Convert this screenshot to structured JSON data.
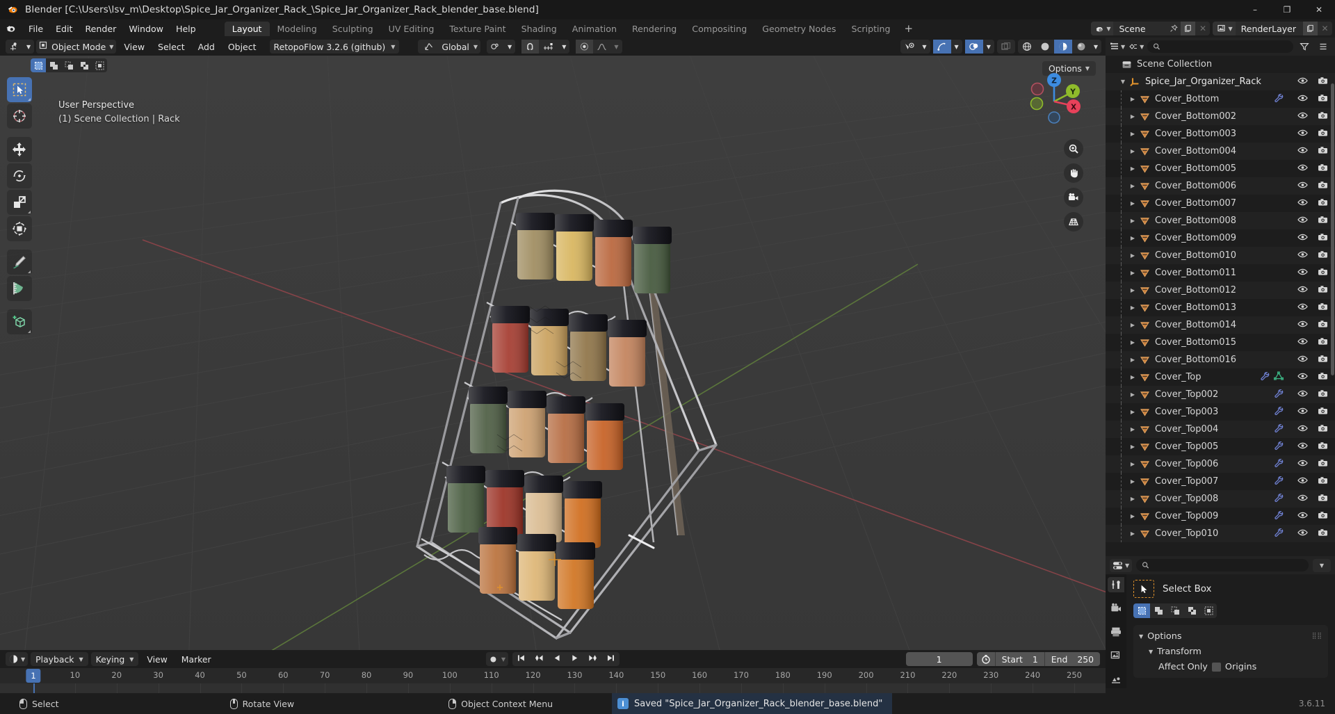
{
  "window": {
    "title": "Blender [C:\\Users\\lsv_m\\Desktop\\Spice_Jar_Organizer_Rack_\\Spice_Jar_Organizer_Rack_blender_base.blend]",
    "minimize": "–",
    "maximize": "❐",
    "close": "✕"
  },
  "menu": {
    "items": [
      "File",
      "Edit",
      "Render",
      "Window",
      "Help"
    ]
  },
  "workspaces": {
    "tabs": [
      "Layout",
      "Modeling",
      "Sculpting",
      "UV Editing",
      "Texture Paint",
      "Shading",
      "Animation",
      "Rendering",
      "Compositing",
      "Geometry Nodes",
      "Scripting"
    ],
    "active": "Layout",
    "add": "+"
  },
  "topbar_right": {
    "scene_name": "Scene",
    "viewlayer_name": "RenderLayer"
  },
  "viewport_header": {
    "mode": "Object Mode",
    "menus": [
      "View",
      "Select",
      "Add",
      "Object"
    ],
    "addon": "RetopoFlow 3.2.6 (github)",
    "transform_orientation": "Global"
  },
  "viewport": {
    "perspective": "User Perspective",
    "collection_line": "(1) Scene Collection | Rack",
    "options_label": "Options",
    "gizmo_axes": {
      "x": "X",
      "y": "Y",
      "z": "Z"
    },
    "colors": {
      "x_axis": "#e7415a",
      "y_axis": "#8fbb2b",
      "z_axis": "#3d8ce0",
      "accent": "#4772b3",
      "orange": "#e0922c"
    }
  },
  "toolbar": {
    "tools": [
      {
        "name": "tweak-tool",
        "icon": "cursor-arrow",
        "active": true
      },
      {
        "name": "cursor-tool",
        "icon": "3d-cursor",
        "active": false
      },
      {
        "name": "move-tool",
        "icon": "move-arrows",
        "active": false
      },
      {
        "name": "rotate-tool",
        "icon": "rotate-circle",
        "active": false
      },
      {
        "name": "scale-tool",
        "icon": "scale-square",
        "active": false
      },
      {
        "name": "transform-tool",
        "icon": "transform-combo",
        "active": false
      },
      {
        "name": "annotate-tool",
        "icon": "pencil",
        "active": false
      },
      {
        "name": "measure-tool",
        "icon": "ruler",
        "active": false
      },
      {
        "name": "add-cube-tool",
        "icon": "add-cube",
        "active": false
      }
    ]
  },
  "outliner": {
    "search_placeholder": "",
    "root": "Scene Collection",
    "collection": "Spice_Jar_Organizer_Rack",
    "items": [
      {
        "label": "Cover_Bottom",
        "modifier": true,
        "mesh_data": false
      },
      {
        "label": "Cover_Bottom002",
        "modifier": false,
        "mesh_data": false
      },
      {
        "label": "Cover_Bottom003",
        "modifier": false,
        "mesh_data": false
      },
      {
        "label": "Cover_Bottom004",
        "modifier": false,
        "mesh_data": false
      },
      {
        "label": "Cover_Bottom005",
        "modifier": false,
        "mesh_data": false
      },
      {
        "label": "Cover_Bottom006",
        "modifier": false,
        "mesh_data": false
      },
      {
        "label": "Cover_Bottom007",
        "modifier": false,
        "mesh_data": false
      },
      {
        "label": "Cover_Bottom008",
        "modifier": false,
        "mesh_data": false
      },
      {
        "label": "Cover_Bottom009",
        "modifier": false,
        "mesh_data": false
      },
      {
        "label": "Cover_Bottom010",
        "modifier": false,
        "mesh_data": false
      },
      {
        "label": "Cover_Bottom011",
        "modifier": false,
        "mesh_data": false
      },
      {
        "label": "Cover_Bottom012",
        "modifier": false,
        "mesh_data": false
      },
      {
        "label": "Cover_Bottom013",
        "modifier": false,
        "mesh_data": false
      },
      {
        "label": "Cover_Bottom014",
        "modifier": false,
        "mesh_data": false
      },
      {
        "label": "Cover_Bottom015",
        "modifier": false,
        "mesh_data": false
      },
      {
        "label": "Cover_Bottom016",
        "modifier": false,
        "mesh_data": false
      },
      {
        "label": "Cover_Top",
        "modifier": true,
        "mesh_data": true
      },
      {
        "label": "Cover_Top002",
        "modifier": true,
        "mesh_data": false
      },
      {
        "label": "Cover_Top003",
        "modifier": true,
        "mesh_data": false
      },
      {
        "label": "Cover_Top004",
        "modifier": true,
        "mesh_data": false
      },
      {
        "label": "Cover_Top005",
        "modifier": true,
        "mesh_data": false
      },
      {
        "label": "Cover_Top006",
        "modifier": true,
        "mesh_data": false
      },
      {
        "label": "Cover_Top007",
        "modifier": true,
        "mesh_data": false
      },
      {
        "label": "Cover_Top008",
        "modifier": true,
        "mesh_data": false
      },
      {
        "label": "Cover_Top009",
        "modifier": true,
        "mesh_data": false
      },
      {
        "label": "Cover_Top010",
        "modifier": true,
        "mesh_data": false
      }
    ]
  },
  "properties": {
    "search_placeholder": "",
    "tool_name": "Select Box",
    "panels": {
      "options": "Options",
      "transform": "Transform",
      "affect_only_label": "Affect Only",
      "origins_label": "Origins"
    }
  },
  "timeline": {
    "menus": [
      "Playback",
      "Keying",
      "View",
      "Marker"
    ],
    "current_frame": "1",
    "start_label": "Start",
    "start_value": "1",
    "end_label": "End",
    "end_value": "250",
    "ticks": [
      "1",
      "10",
      "20",
      "30",
      "40",
      "50",
      "60",
      "70",
      "80",
      "90",
      "100",
      "110",
      "120",
      "130",
      "140",
      "150",
      "160",
      "170",
      "180",
      "190",
      "200",
      "210",
      "220",
      "230",
      "240",
      "250"
    ],
    "playhead_label": "1"
  },
  "statusbar": {
    "hints": [
      {
        "mouse": "left",
        "label": "Select"
      },
      {
        "mouse": "middle",
        "label": "Rotate View"
      },
      {
        "mouse": "right",
        "label": "Object Context Menu"
      }
    ],
    "report": "Saved \"Spice_Jar_Organizer_Rack_blender_base.blend\"",
    "version": "3.6.11"
  }
}
